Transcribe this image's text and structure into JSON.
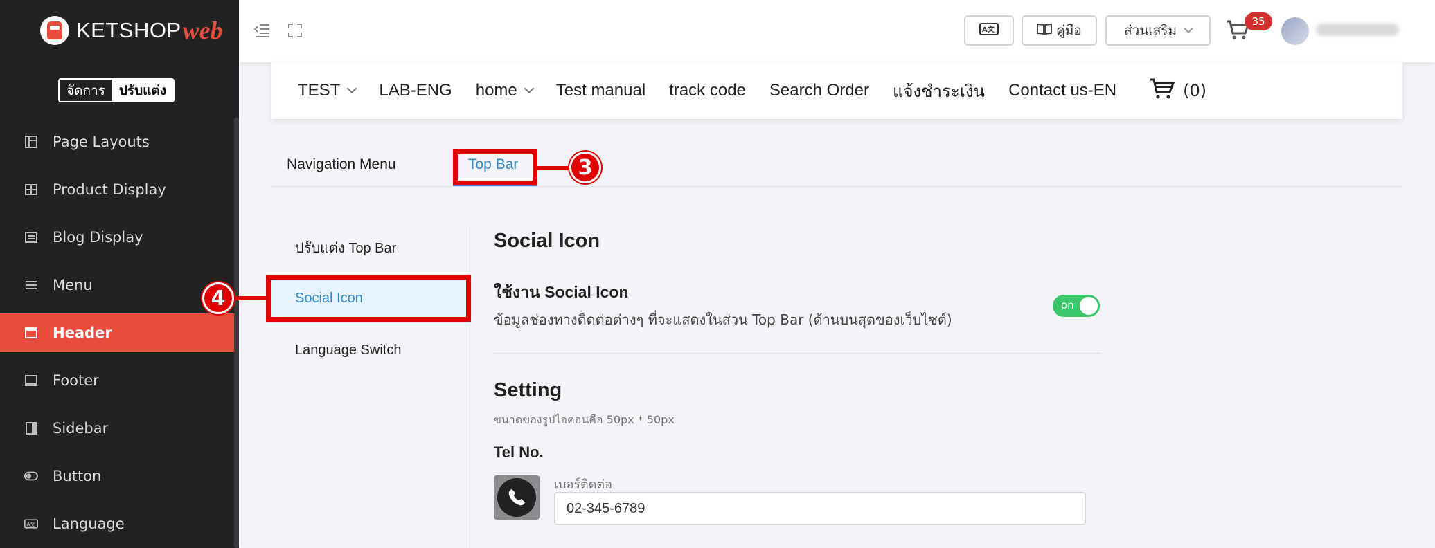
{
  "brand": {
    "name": "KETSHOP",
    "suffix": "web"
  },
  "mode_toggle": {
    "manage": "จัดการ",
    "customize": "ปรับแต่ง"
  },
  "sidebar": {
    "items": [
      {
        "label": "Page Layouts",
        "icon": "layout-icon"
      },
      {
        "label": "Product Display",
        "icon": "grid-icon"
      },
      {
        "label": "Blog Display",
        "icon": "list-icon"
      },
      {
        "label": "Menu",
        "icon": "menu-icon"
      },
      {
        "label": "Header",
        "icon": "window-icon",
        "active": true
      },
      {
        "label": "Footer",
        "icon": "footer-icon"
      },
      {
        "label": "Sidebar",
        "icon": "sidebar-icon"
      },
      {
        "label": "Button",
        "icon": "toggle-icon"
      },
      {
        "label": "Language",
        "icon": "translate-icon"
      }
    ]
  },
  "topbar": {
    "manual_label": "คู่มือ",
    "addons_label": "ส่วนเสริม",
    "cart_count": "35"
  },
  "preview_nav": {
    "items": [
      "TEST",
      "LAB-ENG",
      "home",
      "Test manual",
      "track code",
      "Search Order",
      "แจ้งชำระเงิน",
      "Contact us-EN"
    ],
    "cart_label": "(0)"
  },
  "tabs": {
    "navigation_menu": "Navigation Menu",
    "top_bar": "Top Bar"
  },
  "submenu": {
    "customize_top_bar": "ปรับแต่ง Top Bar",
    "social_icon": "Social Icon",
    "language_switch": "Language Switch"
  },
  "content": {
    "section_title": "Social Icon",
    "enable_title": "ใช้งาน Social Icon",
    "enable_desc": "ข้อมูลช่องทางติดต่อต่างๆ ที่จะแสดงในส่วน Top Bar (ด้านบนสุดของเว็บไซต์)",
    "switch_label": "on",
    "setting_title": "Setting",
    "setting_note": "ขนาดของรูปไอคอนคือ 50px * 50px",
    "tel_title": "Tel No.",
    "tel_label": "เบอร์ติดต่อ",
    "tel_value": "02-345-6789"
  },
  "annotations": {
    "step3": "3",
    "step4": "4"
  },
  "colors": {
    "accent": "#e74c3c",
    "link": "#2f8ac9",
    "switch_on": "#3cc66b",
    "annotation": "#e00000",
    "sidebar_bg": "#222222"
  }
}
